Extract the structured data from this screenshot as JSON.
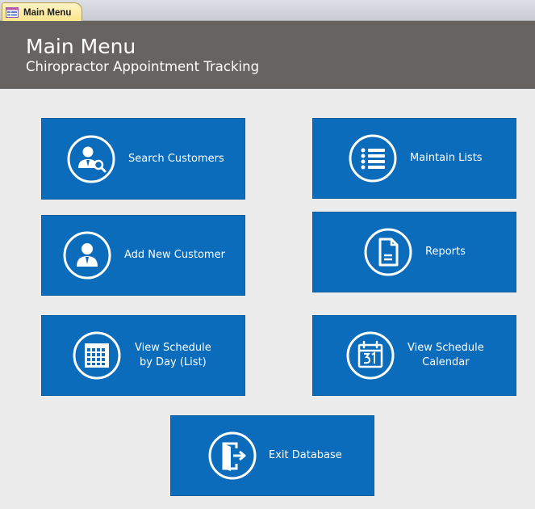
{
  "tab": {
    "label": "Main Menu"
  },
  "header": {
    "title": "Main Menu",
    "subtitle": "Chiropractor Appointment Tracking"
  },
  "buttons": {
    "search_customers": {
      "label": "Search Customers",
      "icon": "search-customer-icon"
    },
    "maintain_lists": {
      "label": "Maintain Lists",
      "icon": "list-icon"
    },
    "add_new_customer": {
      "label": "Add New Customer",
      "icon": "user-icon"
    },
    "reports": {
      "label": "Reports",
      "icon": "document-icon"
    },
    "view_schedule_day": {
      "line1": "View Schedule",
      "line2": "by Day (List)",
      "icon": "calendar-grid-icon"
    },
    "view_schedule_calendar": {
      "line1": "View Schedule",
      "line2": "Calendar",
      "icon": "calendar-31-icon"
    },
    "exit_database": {
      "label": "Exit Database",
      "icon": "exit-door-icon"
    }
  },
  "colors": {
    "button_blue": "#0b6cbc",
    "header_gray": "#676360",
    "background": "#ececec"
  }
}
